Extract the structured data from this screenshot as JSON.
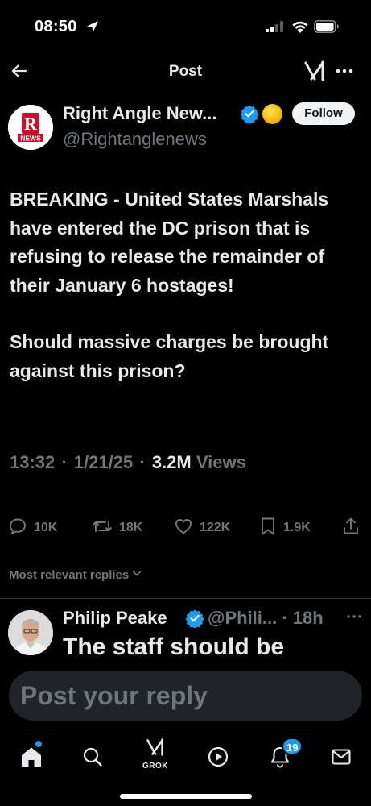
{
  "status_bar": {
    "time": "08:50",
    "location_icon": "location-arrow-icon",
    "signal_icon": "cellular-signal-icon",
    "wifi_icon": "wifi-icon",
    "battery_icon": "battery-icon"
  },
  "header": {
    "title": "Post",
    "back_icon": "back-arrow-icon",
    "grok_icon": "grok-icon",
    "more_icon": "more-horizontal-icon"
  },
  "author": {
    "name": "Right Angle New...",
    "handle": "@Rightanglenews",
    "avatar_text": "R",
    "avatar_caption": "NEWS",
    "verified_icon": "verified-badge-icon",
    "follow_label": "Follow"
  },
  "tweet": {
    "paragraph_1": "BREAKING - United States Marshals have entered the DC prison that is refusing to release the remainder of their January 6 hostages!",
    "paragraph_2": "Should massive charges be brought against this prison?",
    "time": "13:32",
    "date": "1/21/25",
    "views_count": "3.2M",
    "views_label": "Views"
  },
  "actions": {
    "replies": "10K",
    "reposts": "18K",
    "likes": "122K",
    "bookmarks": "1.9K"
  },
  "replies_sort_label": "Most relevant replies",
  "reply": {
    "name": "Philip Peake",
    "handle": "@Phili...",
    "age": "18h",
    "text": "The staff should be"
  },
  "composer": {
    "placeholder": "Post your reply"
  },
  "tab_bar": {
    "grok_label": "GROK",
    "notification_count": "19"
  },
  "colors": {
    "background": "#000000",
    "accent": "#1d9bf0",
    "text_primary": "#e7e9ea",
    "text_secondary": "#71767b",
    "brand_red": "#c8102e"
  }
}
